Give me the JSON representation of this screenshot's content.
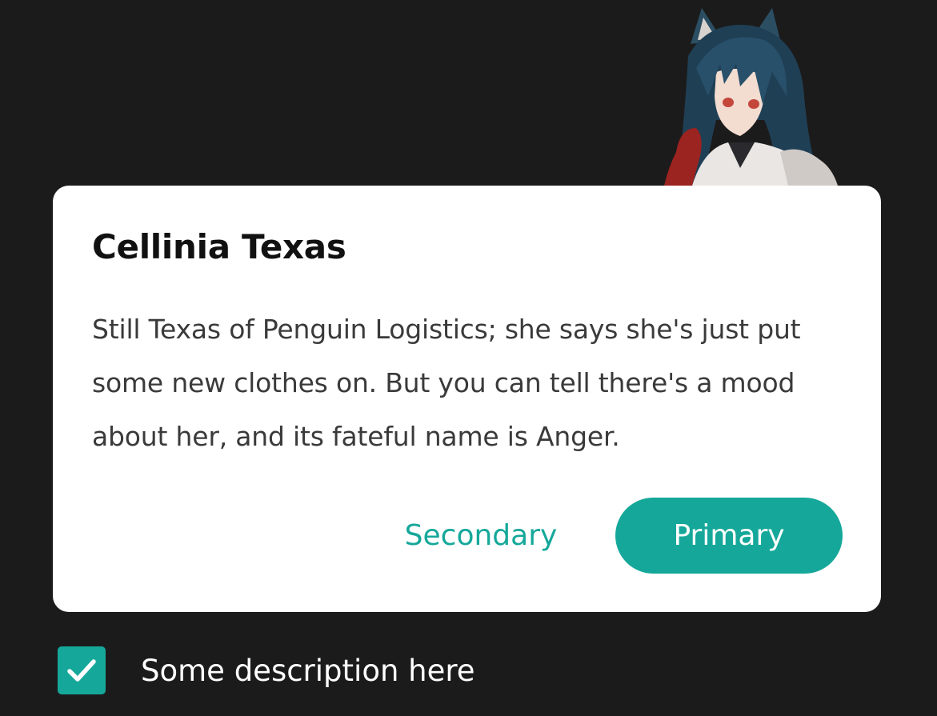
{
  "dialog": {
    "title": "Cellinia Texas",
    "body": "Still Texas of Penguin Logistics; she says she's just put some new clothes on. But you can tell there's a mood about her, and its fateful name is Anger.",
    "secondary_label": "Secondary",
    "primary_label": "Primary"
  },
  "checkbox": {
    "label": "Some description here",
    "checked": true
  },
  "illustration": {
    "icon": "character-portrait-icon"
  },
  "colors": {
    "background": "#1c1b1b",
    "accent": "#15a89a",
    "dialog_bg": "#ffffff"
  }
}
